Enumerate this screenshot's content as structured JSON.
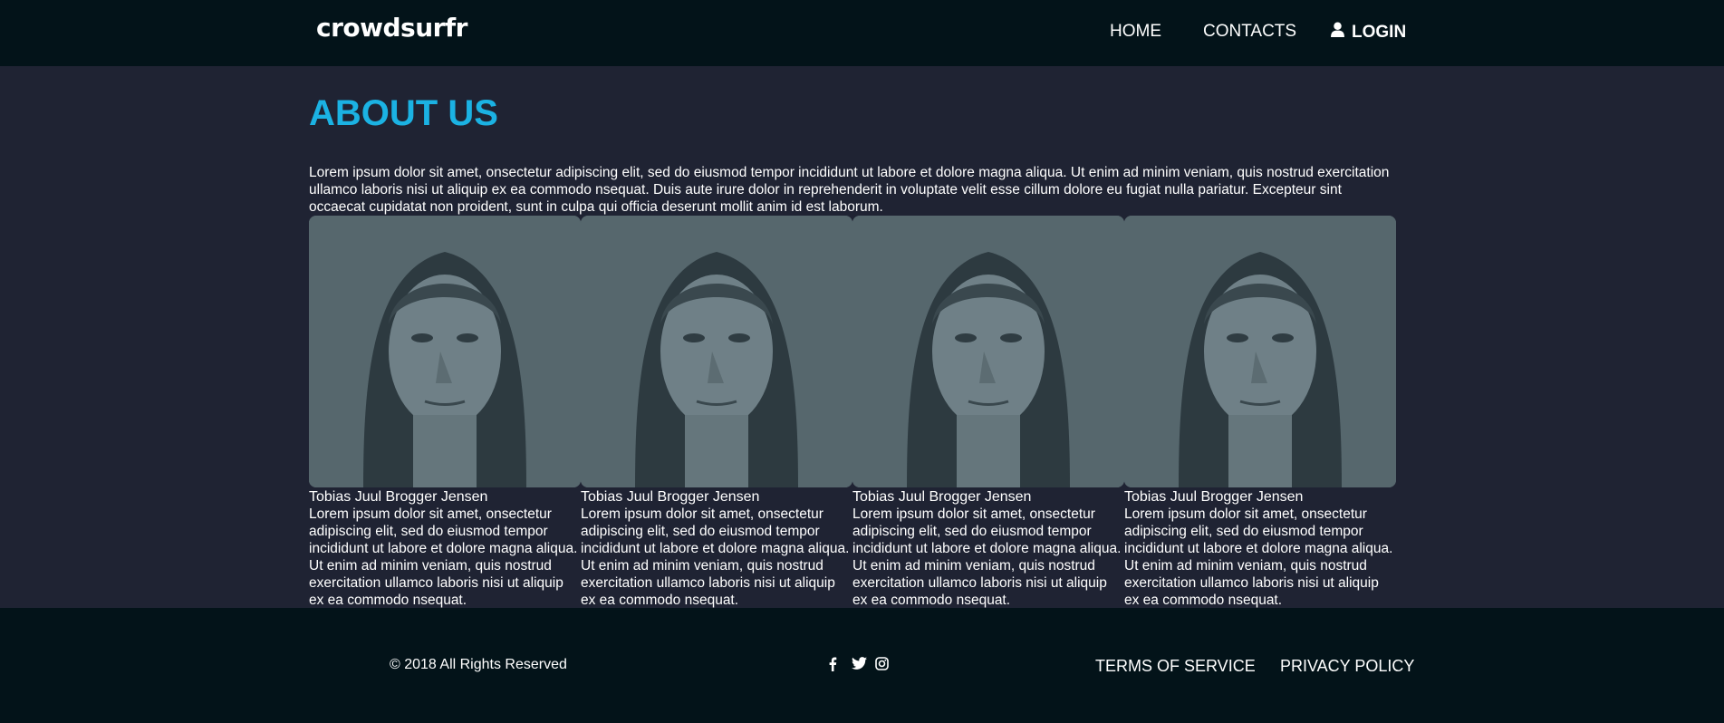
{
  "header": {
    "logo": "crowdsurfr",
    "nav": {
      "home": "HOME",
      "contacts": "CONTACTS",
      "login": "LOGIN"
    }
  },
  "about": {
    "title": "ABOUT US",
    "intro": "Lorem ipsum dolor sit amet, onsectetur adipiscing elit, sed do eiusmod tempor incididunt ut labore et dolore magna aliqua. Ut enim ad minim veniam, quis nostrud exercitation ullamco laboris nisi ut aliquip ex ea commodo nsequat. Duis aute irure dolor in reprehenderit in voluptate velit esse cillum dolore eu fugiat nulla pariatur. Excepteur sint occaecat cupidatat non proident, sunt in culpa qui officia deserunt mollit anim id est laborum."
  },
  "team": [
    {
      "name": "Tobias Juul Brogger Jensen",
      "bio": "Lorem ipsum dolor sit amet, onsectetur adipiscing elit, sed do eiusmod tempor incididunt ut labore et dolore magna aliqua. Ut enim ad minim veniam, quis nostrud exercitation ullamco laboris nisi ut aliquip ex ea commodo nsequat."
    },
    {
      "name": "Tobias Juul Brogger Jensen",
      "bio": "Lorem ipsum dolor sit amet, onsectetur adipiscing elit, sed do eiusmod tempor incididunt ut labore et dolore magna aliqua. Ut enim ad minim veniam, quis nostrud exercitation ullamco laboris nisi ut aliquip ex ea commodo nsequat."
    },
    {
      "name": "Tobias Juul Brogger Jensen",
      "bio": "Lorem ipsum dolor sit amet, onsectetur adipiscing elit, sed do eiusmod tempor incididunt ut labore et dolore magna aliqua. Ut enim ad minim veniam, quis nostrud exercitation ullamco laboris nisi ut aliquip ex ea commodo nsequat."
    },
    {
      "name": "Tobias Juul Brogger Jensen",
      "bio": "Lorem ipsum dolor sit amet, onsectetur adipiscing elit, sed do eiusmod tempor incididunt ut labore et dolore magna aliqua. Ut enim ad minim veniam, quis nostrud exercitation ullamco laboris nisi ut aliquip ex ea commodo nsequat."
    }
  ],
  "footer": {
    "copyright": "© 2018 All Rights Reserved",
    "social_icons": [
      "facebook-icon",
      "twitter-icon",
      "instagram-icon"
    ],
    "terms": "TERMS OF SERVICE",
    "privacy": "PRIVACY POLICY"
  },
  "colors": {
    "accent": "#1bb2e3",
    "header_bg": "#031319",
    "body_bg": "#1f2333",
    "photo_tint": "#56676d"
  }
}
